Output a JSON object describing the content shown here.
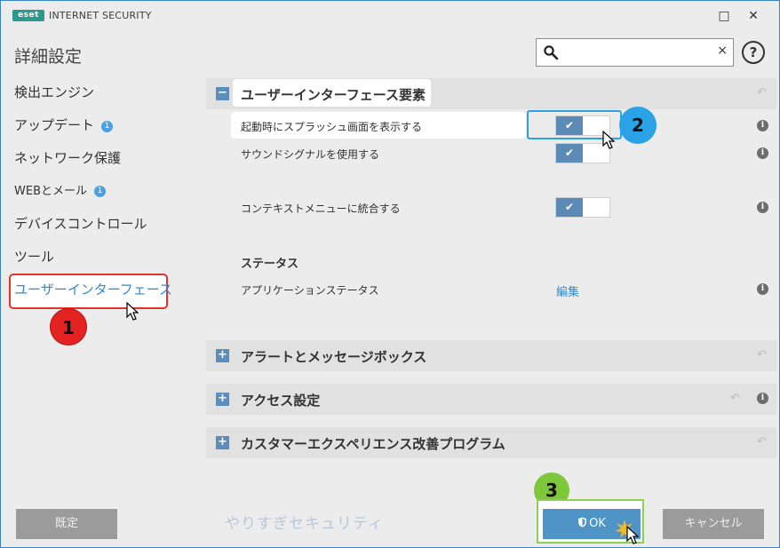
{
  "window": {
    "logo_text": "eset",
    "app_title": "INTERNET SECURITY",
    "minimize_icon": "□",
    "close_icon": "✕"
  },
  "header": {
    "page_title": "詳細設定",
    "search_value": "",
    "search_clear": "×",
    "help_label": "?"
  },
  "sidebar": {
    "items": [
      {
        "label": "検出エンジン"
      },
      {
        "label": "アップデート",
        "badge": "1"
      },
      {
        "label": "ネットワーク保護"
      },
      {
        "label": "WEBとメール",
        "badge": "1"
      },
      {
        "label": "デバイスコントロール"
      },
      {
        "label": "ツール"
      },
      {
        "label": "ユーザーインターフェース"
      }
    ],
    "active_index": 6
  },
  "sections": {
    "ui_elements": {
      "toggle": "−",
      "title": "ユーザーインターフェース要素",
      "rows": [
        {
          "label": "起動時にスプラッシュ画面を表示する",
          "enabled": true
        },
        {
          "label": "サウンドシグナルを使用する",
          "enabled": true
        },
        {
          "label": "コンテキストメニューに統合する",
          "enabled": true
        }
      ],
      "status_heading": "ステータス",
      "status_row_label": "アプリケーションステータス",
      "status_row_link": "編集"
    },
    "alerts": {
      "toggle": "+",
      "title": "アラートとメッセージボックス"
    },
    "access": {
      "toggle": "+",
      "title": "アクセス設定"
    },
    "ceip": {
      "toggle": "+",
      "title": "カスタマーエクスペリエンス改善プログラム"
    }
  },
  "icons": {
    "check": "✔",
    "revert": "↶",
    "info": "i"
  },
  "callouts": {
    "one": "1",
    "two": "2",
    "three": "3"
  },
  "footer": {
    "default_label": "既定",
    "watermark": "やりすぎセキュリティ",
    "ok_label": "OK",
    "cancel_label": "キャンセル"
  },
  "colors": {
    "accent": "#2b8cd1",
    "ok_button": "#4f94c7",
    "callout_1": "#e52222",
    "callout_2": "#2aa3e6",
    "callout_3": "#7cc83a"
  }
}
